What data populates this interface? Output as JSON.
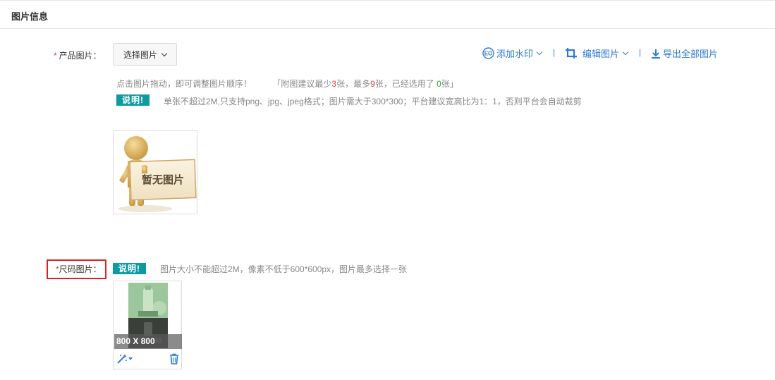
{
  "header": {
    "title": "图片信息"
  },
  "product_images": {
    "required_mark": "*",
    "label": "产品图片：",
    "select_button": "选择图片",
    "toolbar": {
      "watermark": "添加水印",
      "separator": "|",
      "edit": "编辑图片",
      "export": "导出全部图片"
    },
    "hint_prefix": "点击图片拖动，即可调整图片顺序！",
    "hint_bracket_open": "「附图建议最少",
    "hint_min": "3",
    "hint_mid": "张，最多",
    "hint_max": "9",
    "hint_selected_pre": "张，已经选用了",
    "hint_selected": "0",
    "hint_suffix": "张」",
    "badge": "说明!",
    "note": "单张不超过2M,只支持png、jpg、jpeg格式；图片需大于300*300；平台建议宽高比为1：1，否则平台会自动裁剪",
    "placeholder_text": "暂无图片"
  },
  "size_images": {
    "required_mark": "*",
    "label": "尺码图片：",
    "badge": "说明!",
    "note": "图片大小不能超过2M，像素不低于600*600px，图片最多选择一张",
    "thumb_caption": "800 X 800"
  },
  "colors": {
    "accent": "#2e7bd3",
    "badge": "#0f9aa0",
    "required": "#e4393c",
    "highlight_box": "#e02020"
  }
}
